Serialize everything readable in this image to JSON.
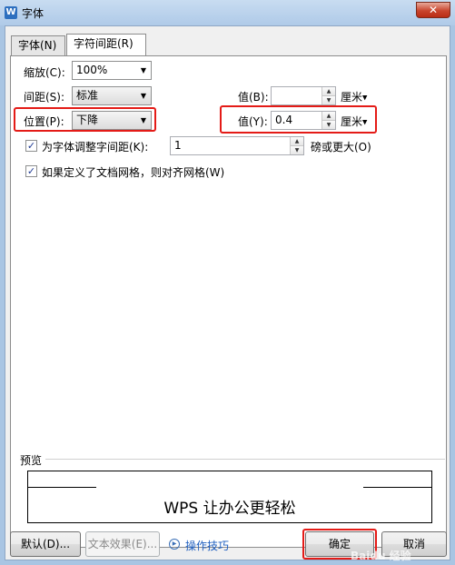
{
  "window": {
    "title": "字体",
    "icon_glyph": "W",
    "close_glyph": "✕"
  },
  "tabs": [
    {
      "label": "字体(N)",
      "active": false
    },
    {
      "label": "字符间距(R)",
      "active": true
    }
  ],
  "form": {
    "scale_label": "缩放(C):",
    "scale_value": "100%",
    "spacing_label": "间距(S):",
    "spacing_value": "标准",
    "spacing_amount_label": "值(B):",
    "spacing_amount_value": "",
    "spacing_unit": "厘米",
    "position_label": "位置(P):",
    "position_value": "下降",
    "position_amount_label": "值(Y):",
    "position_amount_value": "0.4",
    "position_unit": "厘米",
    "kerning_label": "为字体调整字间距(K):",
    "kerning_checked": true,
    "kerning_value": "1",
    "kerning_suffix": "磅或更大(O)",
    "grid_label": "如果定义了文档网格，则对齐网格(W)",
    "grid_checked": true
  },
  "preview": {
    "label": "预览",
    "text": "WPS 让办公更轻松"
  },
  "buttons": {
    "default": "默认(D)...",
    "text_effect": "文本效果(E)...",
    "tips": "操作技巧",
    "ok": "确定",
    "cancel": "取消"
  },
  "watermark": "Baidu 经验",
  "colors": {
    "highlight_red": "#e41b17",
    "link_blue": "#1e5ebf"
  }
}
